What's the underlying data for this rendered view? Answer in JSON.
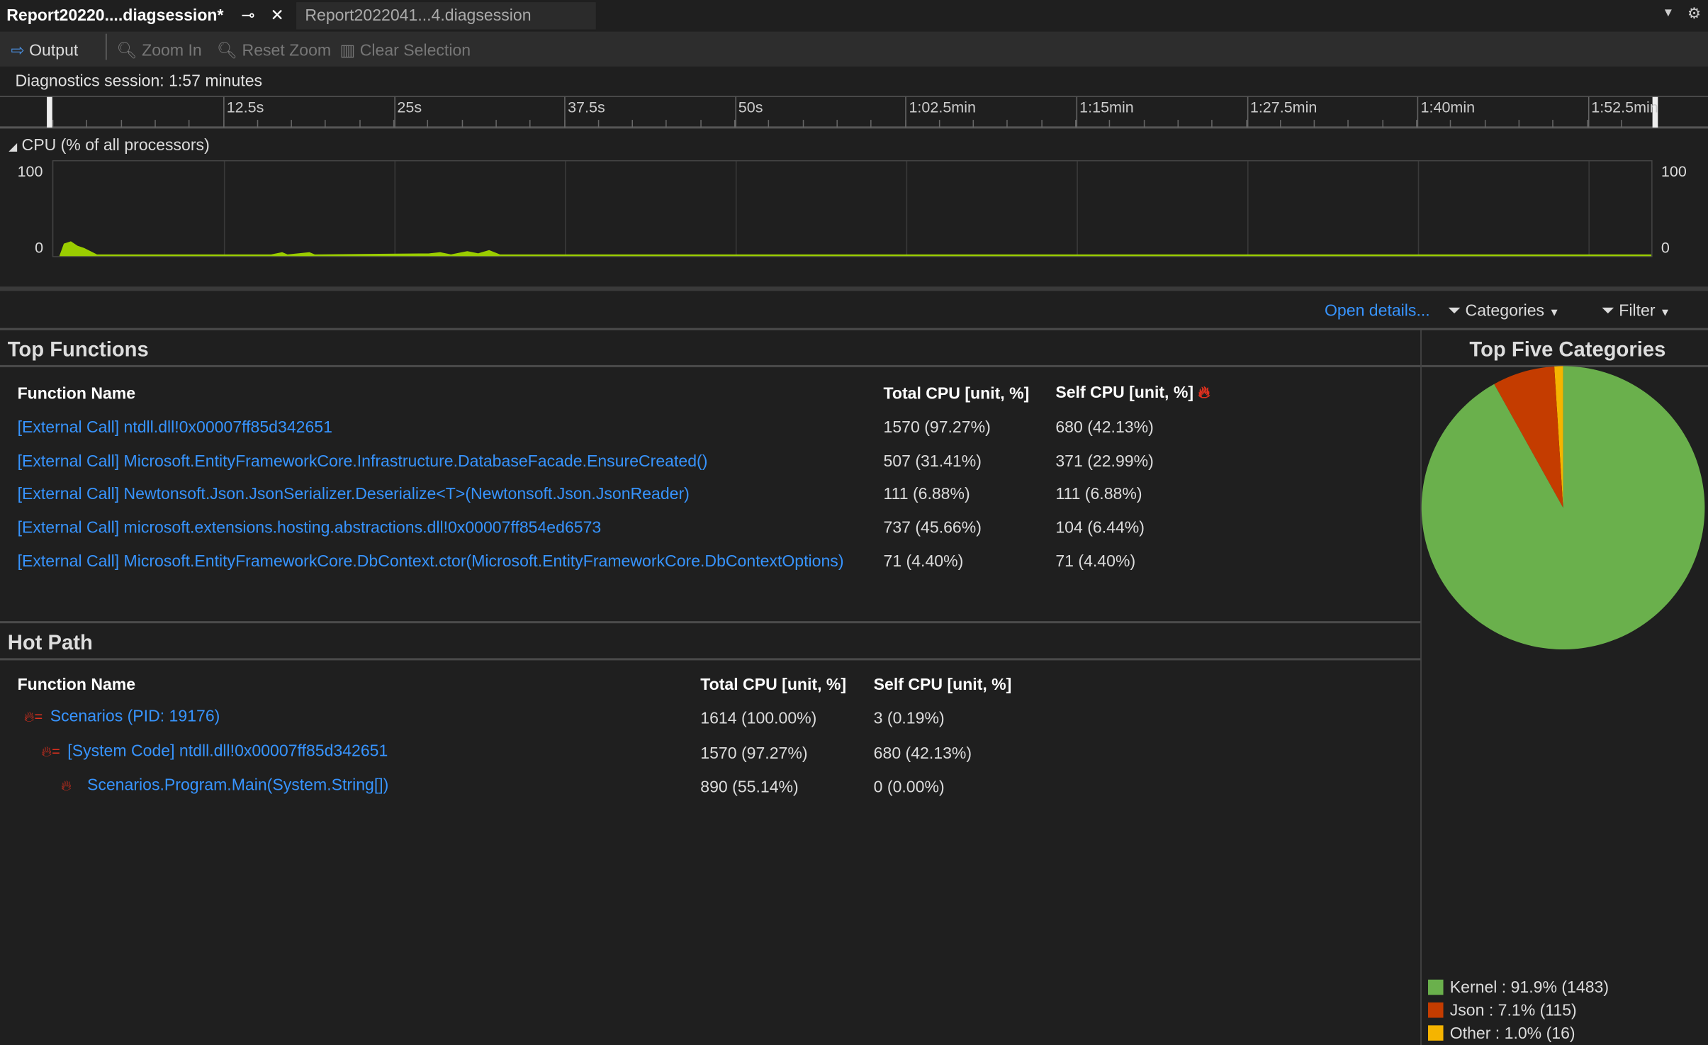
{
  "tabs": [
    {
      "label": "Report20220....diagsession*",
      "active": true
    },
    {
      "label": "Report2022041...4.diagsession",
      "active": false
    }
  ],
  "toolbar": {
    "output": "Output",
    "zoom_in": "Zoom In",
    "reset_zoom": "Reset Zoom",
    "clear_selection": "Clear Selection"
  },
  "session": "Diagnostics session: 1:57 minutes",
  "ruler": [
    "12.5s",
    "25s",
    "37.5s",
    "50s",
    "1:02.5min",
    "1:15min",
    "1:27.5min",
    "1:40min",
    "1:52.5min"
  ],
  "cpu": {
    "title": "CPU (% of all processors)",
    "ymax": "100",
    "ymin": "0"
  },
  "actions": {
    "open_details": "Open details...",
    "categories": "Categories",
    "filter": "Filter"
  },
  "top_functions": {
    "title": "Top Functions",
    "headers": [
      "Function Name",
      "Total CPU [unit, %]",
      "Self CPU [unit, %]"
    ],
    "rows": [
      [
        "[External Call] ntdll.dll!0x00007ff85d342651",
        "1570 (97.27%)",
        "680 (42.13%)"
      ],
      [
        "[External Call] Microsoft.EntityFrameworkCore.Infrastructure.DatabaseFacade.EnsureCreated()",
        "507 (31.41%)",
        "371 (22.99%)"
      ],
      [
        "[External Call] Newtonsoft.Json.JsonSerializer.Deserialize<T>(Newtonsoft.Json.JsonReader)",
        "111 (6.88%)",
        "111 (6.88%)"
      ],
      [
        "[External Call] microsoft.extensions.hosting.abstractions.dll!0x00007ff854ed6573",
        "737 (45.66%)",
        "104 (6.44%)"
      ],
      [
        "[External Call] Microsoft.EntityFrameworkCore.DbContext.ctor(Microsoft.EntityFrameworkCore.DbContextOptions)",
        "71 (4.40%)",
        "71 (4.40%)"
      ]
    ]
  },
  "hot_path": {
    "title": "Hot Path",
    "headers": [
      "Function Name",
      "Total CPU [unit, %]",
      "Self CPU [unit, %]"
    ],
    "rows": [
      [
        "Scenarios (PID: 19176)",
        "1614 (100.00%)",
        "3 (0.19%)"
      ],
      [
        "[System Code] ntdll.dll!0x00007ff85d342651",
        "1570 (97.27%)",
        "680 (42.13%)"
      ],
      [
        "Scenarios.Program.Main(System.String[])",
        "890 (55.14%)",
        "0 (0.00%)"
      ]
    ]
  },
  "categories": {
    "title": "Top Five Categories",
    "items": [
      {
        "label": "Kernel : 91.9% (1483)",
        "value": 91.9,
        "color": "#6ab04c"
      },
      {
        "label": "Json : 7.1% (115)",
        "value": 7.1,
        "color": "#c43c00"
      },
      {
        "label": "Other : 1.0% (16)",
        "value": 1.0,
        "color": "#f5b400"
      }
    ]
  }
}
